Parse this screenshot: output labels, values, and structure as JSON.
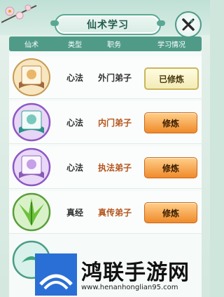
{
  "dialog": {
    "title": "仙术学习",
    "close_icon": "close-brush-icon"
  },
  "table": {
    "headers": [
      "仙术",
      "类型",
      "职务",
      "学习情况"
    ],
    "rows": [
      {
        "icon": "book-icon",
        "type": "心法",
        "role": "外门弟子",
        "status": "已修炼",
        "role_color": "#333333",
        "state": "done"
      },
      {
        "icon": "book-icon",
        "type": "心法",
        "role": "内门弟子",
        "status": "修炼",
        "role_color": "#b5551d",
        "state": "learn"
      },
      {
        "icon": "book-icon",
        "type": "心法",
        "role": "执法弟子",
        "status": "修炼",
        "role_color": "#b5551d",
        "state": "learn"
      },
      {
        "icon": "leaf-icon",
        "type": "真经",
        "role": "真传弟子",
        "status": "修炼",
        "role_color": "#b5551d",
        "state": "learn"
      }
    ]
  },
  "watermark": {
    "name": "鸿联手游网",
    "url": "www.henanhonglian95.com"
  }
}
